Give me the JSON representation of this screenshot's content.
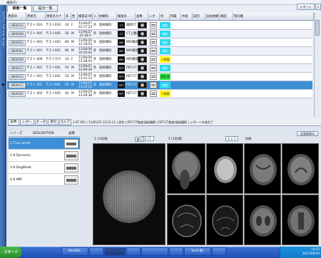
{
  "top": {
    "left_menu": "検索(F)",
    "tabs": [
      "検索一覧",
      "提示一覧"
    ],
    "right_buttons": [
      "レポート",
      "",
      "×"
    ]
  },
  "left_vertical": "メニュー ファイル メンテ",
  "grid": {
    "headers": [
      "患者ID",
      "患者名",
      "患者名カナ",
      "年",
      "性",
      "検査日\n時刻",
      "入",
      "依頼科",
      "検査名",
      "画像",
      "レポ",
      "所",
      "所属",
      "中途",
      "前回",
      "追加依頼",
      "確認",
      "院内番"
    ],
    "rows": [
      {
        "id": "0800010",
        "name": "テスト 010",
        "kana": "テスト010",
        "age": "10",
        "sex": "F",
        "date": "11/06/27",
        "time": "12:17:23",
        "io": "外",
        "dept": "放射線科",
        "mod": "CT",
        "exam": "頭部CT",
        "status": "確定",
        "status_color": "#29d9f1"
      },
      {
        "id": "0800008",
        "name": "テスト 005",
        "kana": "テスト005",
        "age": "50",
        "sex": "M",
        "date": "11/06/27",
        "time": "15:36:5",
        "io": "外",
        "dept": "放射線科",
        "mod": "CT",
        "exam": "CT上腹部",
        "status": "確定",
        "status_color": "#29d9f1"
      },
      {
        "id": "0800003",
        "name": "テスト 003",
        "kana": "テスト003",
        "age": "80",
        "sex": "M",
        "date": "11/06/26",
        "time": "11:18:53",
        "io": "外",
        "dept": "放射線科",
        "mod": "MR",
        "exam": "MRI頭部",
        "status": "確定",
        "status_color": "#29d9f1"
      },
      {
        "id": "0800001",
        "name": "テスト 001",
        "kana": "テスト001",
        "age": "80",
        "sex": "M",
        "date": "11/06/26",
        "time": "10:50:42",
        "io": "外",
        "dept": "放射線科",
        "mod": "MR",
        "exam": "MRI頭部",
        "status": "確定",
        "status_color": "#29d9f1"
      },
      {
        "id": "0800009",
        "name": "テスト 009",
        "kana": "テストカウ",
        "age": "14",
        "sex": "F",
        "date": "11/06/26",
        "time": "13:38:43",
        "io": "外",
        "dept": "放射線科",
        "mod": "MR",
        "exam": "MRI頭部",
        "status": "一時保",
        "status_color": "#fff11c"
      },
      {
        "id": "0800012",
        "name": "テスト 001",
        "kana": "テスト001",
        "age": "50",
        "sex": "M",
        "date": "11/06/25",
        "time": "13:09:49",
        "io": "外",
        "dept": "放射線科",
        "mod": "PET",
        "exam": "PET-CT",
        "status": "確定",
        "status_color": "#29d9f1"
      },
      {
        "id": "0800012",
        "name": "テスト 001",
        "kana": "テスト001",
        "age": "50",
        "sex": "M",
        "date": "11/06/25",
        "time": "13:11:13",
        "io": "外",
        "dept": "放射線科",
        "mod": "PET",
        "exam": "PET-CT",
        "status": "確定済",
        "status_color": "#2ee04a"
      },
      {
        "id": "0800012",
        "name": "テスト 001",
        "kana": "テスト001",
        "age": "50",
        "sex": "M",
        "date": "11/06/25",
        "time": "13:26:15",
        "io": "外",
        "dept": "放射線科",
        "mod": "PET",
        "exam": "PET-CT",
        "status": "確定",
        "status_color": "#29d9f1"
      },
      {
        "id": "0800005",
        "name": "テスト 002",
        "kana": "テスト002",
        "age": "40",
        "sex": "M",
        "date": "11/06/29",
        "time": "13:49:38",
        "io": "外",
        "dept": "放射線科",
        "mod": "PET",
        "exam": "PET-CT",
        "status": "一時保",
        "status_color": "#fff11c"
      }
    ],
    "selected_index": 7
  },
  "lower": {
    "tabs": [
      "画像",
      "レポート",
      "オーダ",
      "添付",
      "カルテ"
    ],
    "info": "3.0T 001 | 11/05/25 13:51:11 | 男性 | PET-CT検査/頭部撮影 | PET-CT検査/頭部撮影 | レポート作成完了",
    "series_headers": [
      "シリーズ",
      "DESCRIPTION",
      "画像"
    ],
    "series": [
      "1 T1w series",
      "2 K.Dynamic",
      "3 K.DegMask",
      "4 K.MIP"
    ],
    "viewer_label": "1 (1)比較",
    "viewer_label2": "1 (1)比較",
    "page_indicator": "1 / 1",
    "btn_prev": "前へ",
    "btn_next": "次へ",
    "zoom": "1 × 1",
    "compare": "比較",
    "right_btn": "全画面表示"
  },
  "taskbar": {
    "start": "スタート",
    "items": [
      "WordPa...",
      "",
      "",
      "",
      "",
      "Yumi 録...",
      "",
      ""
    ],
    "clock": "14:53\n2011/06/29"
  }
}
